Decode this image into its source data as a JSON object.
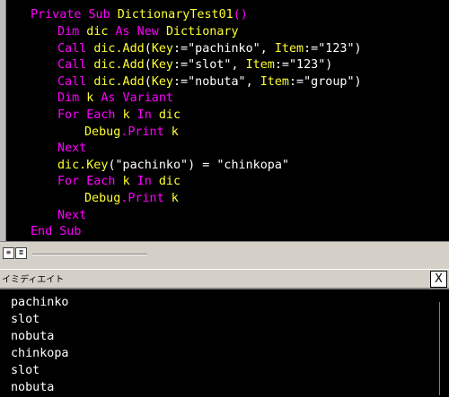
{
  "code": {
    "lines": [
      {
        "tokens": [
          {
            "t": "Private Sub ",
            "c": "kw"
          },
          {
            "t": "DictionaryTest01",
            "c": "id"
          },
          {
            "t": "()",
            "c": "kw"
          }
        ],
        "indent": 0
      },
      {
        "tokens": [
          {
            "t": "Dim ",
            "c": "kw"
          },
          {
            "t": "dic",
            "c": "id"
          },
          {
            "t": " As New ",
            "c": "kw"
          },
          {
            "t": "Dictionary",
            "c": "id"
          }
        ],
        "indent": 1
      },
      {
        "tokens": [
          {
            "t": "Call ",
            "c": "kw"
          },
          {
            "t": "dic.Add",
            "c": "id"
          },
          {
            "t": "(",
            "c": "op"
          },
          {
            "t": "Key",
            "c": "id"
          },
          {
            "t": ":=\"pachinko\", ",
            "c": "op"
          },
          {
            "t": "Item",
            "c": "id"
          },
          {
            "t": ":=\"123\")",
            "c": "op"
          }
        ],
        "indent": 1
      },
      {
        "tokens": [
          {
            "t": "Call ",
            "c": "kw"
          },
          {
            "t": "dic.Add",
            "c": "id"
          },
          {
            "t": "(",
            "c": "op"
          },
          {
            "t": "Key",
            "c": "id"
          },
          {
            "t": ":=\"slot\", ",
            "c": "op"
          },
          {
            "t": "Item",
            "c": "id"
          },
          {
            "t": ":=\"123\")",
            "c": "op"
          }
        ],
        "indent": 1
      },
      {
        "tokens": [
          {
            "t": "Call ",
            "c": "kw"
          },
          {
            "t": "dic.Add",
            "c": "id"
          },
          {
            "t": "(",
            "c": "op"
          },
          {
            "t": "Key",
            "c": "id"
          },
          {
            "t": ":=\"nobuta\", ",
            "c": "op"
          },
          {
            "t": "Item",
            "c": "id"
          },
          {
            "t": ":=\"group\")",
            "c": "op"
          }
        ],
        "indent": 1
      },
      {
        "tokens": [
          {
            "t": "Dim ",
            "c": "kw"
          },
          {
            "t": "k",
            "c": "id"
          },
          {
            "t": " As Variant",
            "c": "kw"
          }
        ],
        "indent": 1
      },
      {
        "tokens": [
          {
            "t": "For Each ",
            "c": "kw"
          },
          {
            "t": "k",
            "c": "id"
          },
          {
            "t": " In ",
            "c": "kw"
          },
          {
            "t": "dic",
            "c": "id"
          }
        ],
        "indent": 1
      },
      {
        "tokens": [
          {
            "t": "Debug",
            "c": "id"
          },
          {
            "t": ".Print ",
            "c": "kw"
          },
          {
            "t": "k",
            "c": "id"
          }
        ],
        "indent": 2
      },
      {
        "tokens": [
          {
            "t": "Next",
            "c": "kw"
          }
        ],
        "indent": 1
      },
      {
        "tokens": [
          {
            "t": "dic.Key",
            "c": "id"
          },
          {
            "t": "(\"pachinko\") = \"chinkopa\"",
            "c": "op"
          }
        ],
        "indent": 1
      },
      {
        "tokens": [
          {
            "t": "For Each ",
            "c": "kw"
          },
          {
            "t": "k",
            "c": "id"
          },
          {
            "t": " In ",
            "c": "kw"
          },
          {
            "t": "dic",
            "c": "id"
          }
        ],
        "indent": 1
      },
      {
        "tokens": [
          {
            "t": "Debug",
            "c": "id"
          },
          {
            "t": ".Print ",
            "c": "kw"
          },
          {
            "t": "k",
            "c": "id"
          }
        ],
        "indent": 2
      },
      {
        "tokens": [
          {
            "t": "Next",
            "c": "kw"
          }
        ],
        "indent": 1
      },
      {
        "tokens": [
          {
            "t": "End Sub",
            "c": "kw"
          }
        ],
        "indent": 0
      }
    ]
  },
  "statusbar": {
    "proc_view_icon": "procedure-view-icon",
    "full_view_icon": "full-module-view-icon"
  },
  "immediate": {
    "title": "イミディエイト",
    "close_label": "X",
    "output": [
      "pachinko",
      "slot",
      "nobuta",
      "chinkopa",
      "slot",
      "nobuta"
    ]
  },
  "colors": {
    "keyword": "#ff00ff",
    "identifier": "#ffff33",
    "text": "#ffffff",
    "background": "#000000"
  }
}
